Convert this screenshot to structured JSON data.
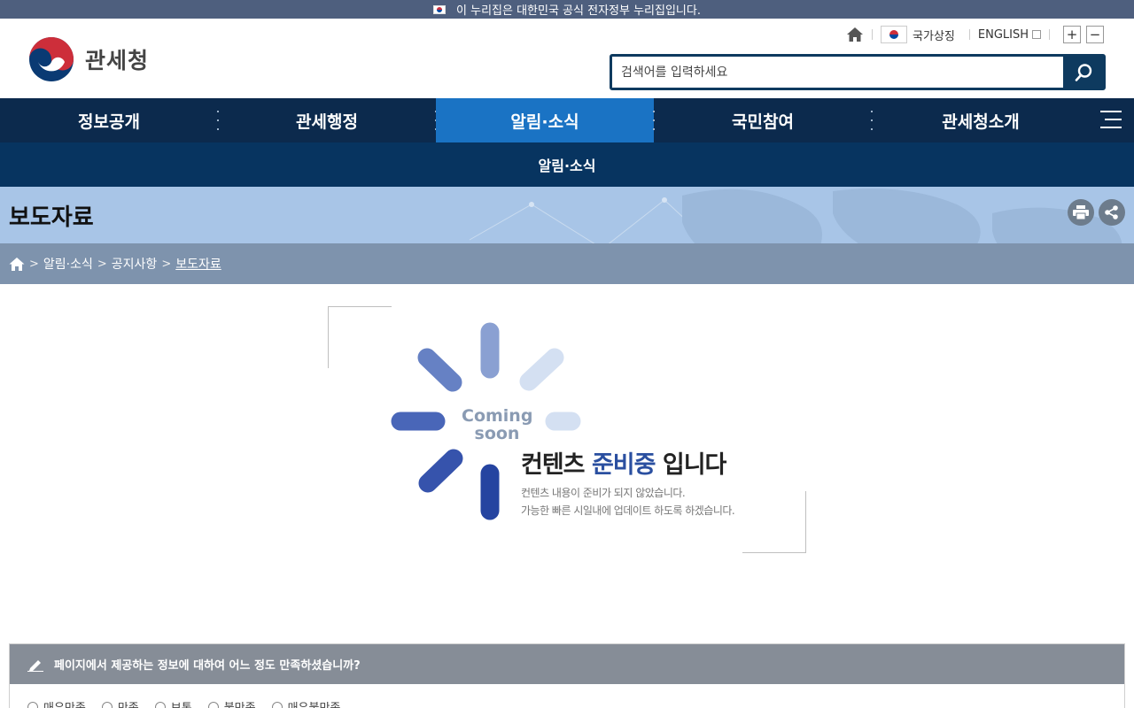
{
  "gov_banner": {
    "text": "이 누리집은 대한민국 공식 전자정부 누리집입니다."
  },
  "logo": {
    "text": "관세청"
  },
  "util": {
    "symbol_label": "국가상징",
    "english_label": "ENGLISH",
    "zoom_in": "+",
    "zoom_out": "−"
  },
  "search": {
    "placeholder": "검색어를 입력하세요"
  },
  "gnb": {
    "items": [
      "정보공개",
      "관세행정",
      "알림·소식",
      "국민참여",
      "관세청소개"
    ],
    "active_index": 2
  },
  "sub_nav": {
    "label": "알림·소식"
  },
  "page": {
    "title": "보도자료"
  },
  "breadcrumb": {
    "items": [
      "알림·소식",
      "공지사항",
      "보도자료"
    ]
  },
  "coming_soon": {
    "word1": "Coming",
    "word2": "soon",
    "heading_pre": "컨텐츠",
    "heading_highlight": "준비중",
    "heading_post": "입니다",
    "desc_line1": "컨텐츠 내용이 준비가 되지 않았습니다.",
    "desc_line2": "가능한 빠른 시일내에 업데이트 하도록 하겠습니다."
  },
  "survey": {
    "question": "페이지에서 제공하는 정보에 대하여 어느 정도 만족하셨습니까?",
    "options": [
      "매우만족",
      "만족",
      "보통",
      "불만족",
      "매우불만족"
    ]
  },
  "colors": {
    "header_nav": "#0c2a4d",
    "active_nav": "#1a73c4",
    "sub_nav": "#073460",
    "title_band": "#a8c5e7",
    "breadcrumb": "#7e93ad",
    "highlight": "#2a4fa0"
  }
}
